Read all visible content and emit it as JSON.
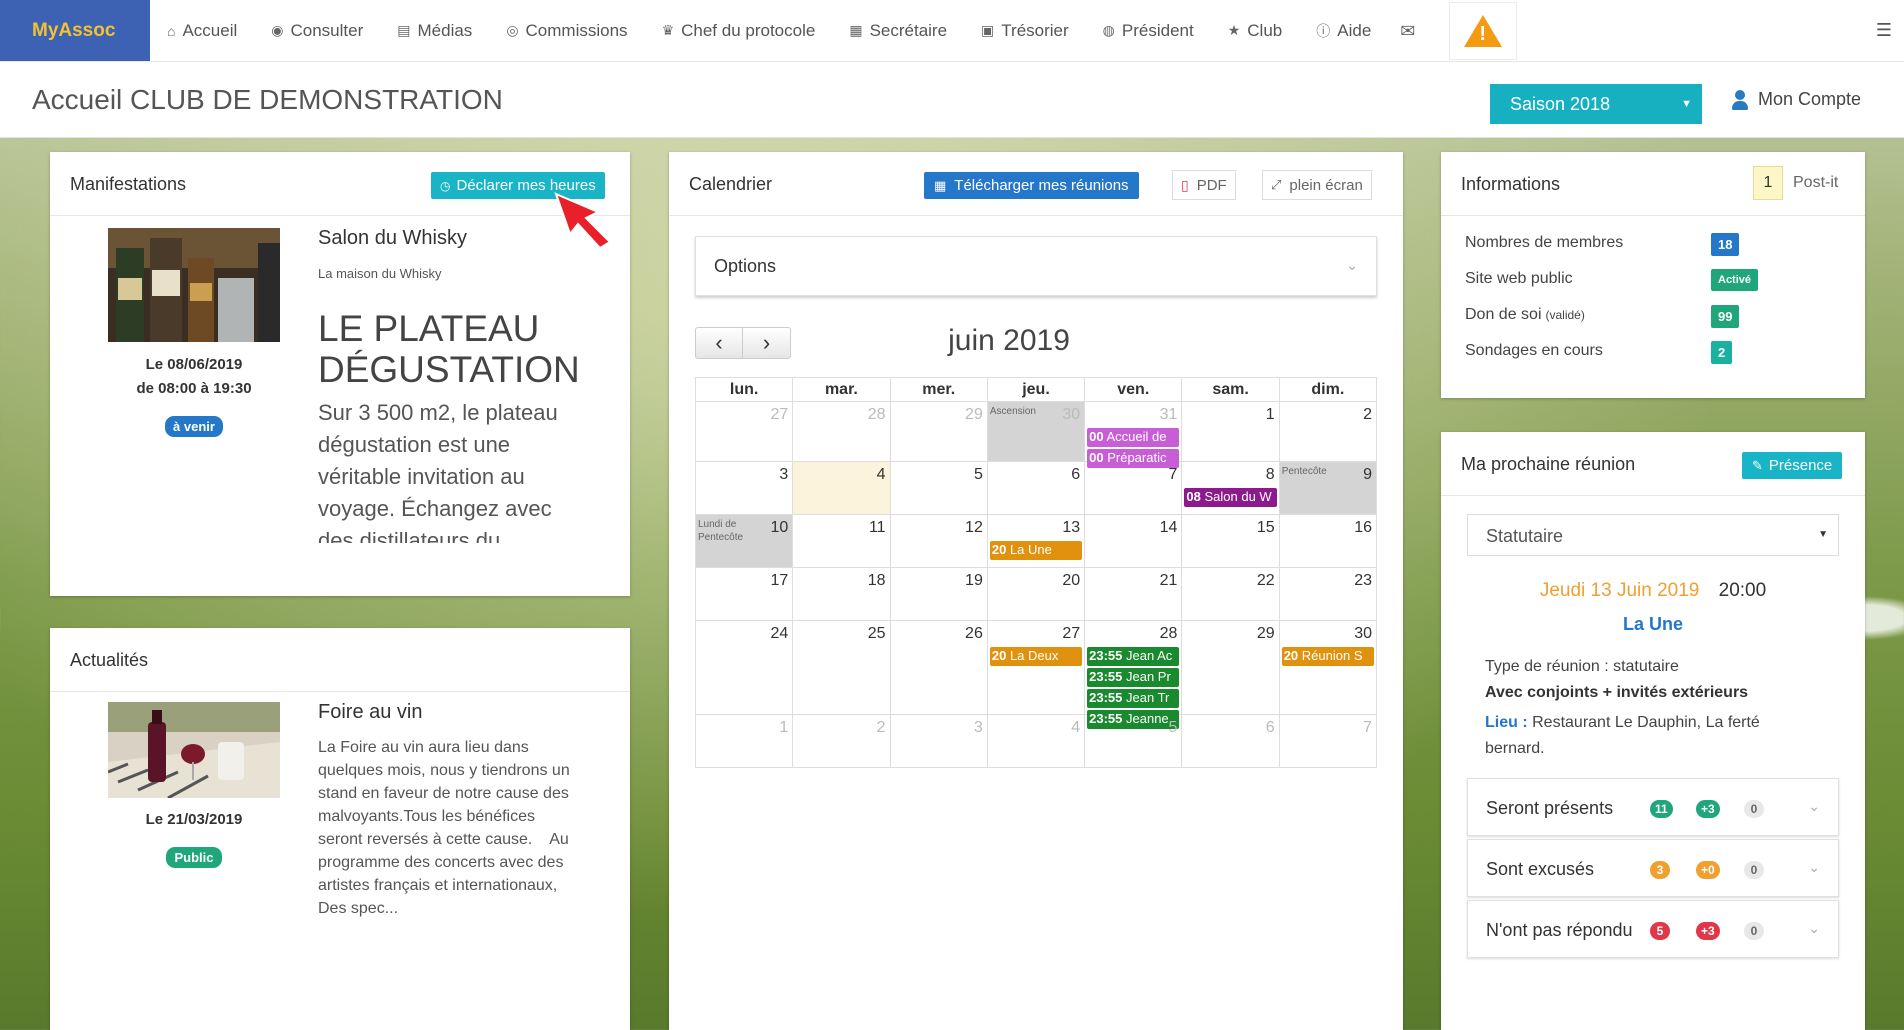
{
  "brand": "MyAssoc",
  "nav": [
    {
      "icon": "home-icon",
      "glyph": "⌂",
      "label": "Accueil"
    },
    {
      "icon": "eye-icon",
      "glyph": "◉",
      "label": "Consulter"
    },
    {
      "icon": "file-icon",
      "glyph": "▤",
      "label": "Médias"
    },
    {
      "icon": "users-icon",
      "glyph": "◎",
      "label": "Commissions"
    },
    {
      "icon": "trophy-icon",
      "glyph": "♛",
      "label": "Chef du protocole"
    },
    {
      "icon": "book-icon",
      "glyph": "▦",
      "label": "Secrétaire"
    },
    {
      "icon": "money-icon",
      "glyph": "▣",
      "label": "Trésorier"
    },
    {
      "icon": "globe-icon",
      "glyph": "◍",
      "label": "Président"
    },
    {
      "icon": "star-icon",
      "glyph": "★",
      "label": "Club"
    },
    {
      "icon": "info-icon",
      "glyph": "ⓘ",
      "label": "Aide"
    }
  ],
  "header": {
    "title": "Accueil CLUB DE DEMONSTRATION",
    "season": "Saison 2018",
    "account": "Mon Compte"
  },
  "manifestations": {
    "title": "Manifestations",
    "declare_button": "Déclarer mes heures",
    "event_title": "Salon du Whisky",
    "event_subtitle": "La maison du Whisky",
    "date_line": "Le 08/06/2019",
    "time_line": "de 08:00 à 19:30",
    "badge": "à venir",
    "headline": "LE PLATEAU DÉGUSTATION",
    "body": "Sur 3 500 m2, le plateau dégustation est une véritable invitation au voyage. Échangez avec des distillateurs du"
  },
  "actualites": {
    "title": "Actualités",
    "event_title": "Foire au vin",
    "date_line": "Le 21/03/2019",
    "badge": "Public",
    "body": "La Foire au vin aura lieu dans quelques mois, nous y tiendrons un stand en faveur de notre cause des malvoyants.Tous les bénéfices seront reversés à cette cause.    Au programme des concerts avec des artistes français et internationaux, Des spec..."
  },
  "calendar": {
    "title": "Calendrier",
    "download_button": "Télécharger mes réunions",
    "pdf_button": "PDF",
    "fullscreen_button": "plein écran",
    "options_label": "Options",
    "month_label": "juin 2019",
    "prev": "‹",
    "next": "›",
    "weekdays": [
      "lun.",
      "mar.",
      "mer.",
      "jeu.",
      "ven.",
      "sam.",
      "dim."
    ],
    "weeks": [
      [
        {
          "d": "27",
          "dim": true
        },
        {
          "d": "28",
          "dim": true
        },
        {
          "d": "29",
          "dim": true
        },
        {
          "d": "30",
          "dim": true,
          "holiday": "Ascension"
        },
        {
          "d": "31",
          "dim": true,
          "events": [
            {
              "time": "00",
              "text": "Accueil de",
              "color": "#c85ed6"
            },
            {
              "time": "00",
              "text": "Préparatic",
              "color": "#c85ed6"
            }
          ]
        },
        {
          "d": "1"
        },
        {
          "d": "2"
        }
      ],
      [
        {
          "d": "3"
        },
        {
          "d": "4",
          "today": true
        },
        {
          "d": "5"
        },
        {
          "d": "6"
        },
        {
          "d": "7"
        },
        {
          "d": "8",
          "events": [
            {
              "time": "08",
              "text": "Salon du W",
              "color": "#8c1a8c"
            }
          ]
        },
        {
          "d": "9",
          "holiday": "Pentecôte"
        }
      ],
      [
        {
          "d": "10",
          "holiday": "Lundi de Pentecôte"
        },
        {
          "d": "11"
        },
        {
          "d": "12"
        },
        {
          "d": "13",
          "events": [
            {
              "time": "20",
              "text": "La Une",
              "color": "#e0920e"
            }
          ]
        },
        {
          "d": "14"
        },
        {
          "d": "15"
        },
        {
          "d": "16"
        }
      ],
      [
        {
          "d": "17"
        },
        {
          "d": "18"
        },
        {
          "d": "19"
        },
        {
          "d": "20"
        },
        {
          "d": "21"
        },
        {
          "d": "22"
        },
        {
          "d": "23"
        }
      ],
      [
        {
          "d": "24"
        },
        {
          "d": "25"
        },
        {
          "d": "26"
        },
        {
          "d": "27",
          "events": [
            {
              "time": "20",
              "text": "La Deux",
              "color": "#e0920e"
            }
          ]
        },
        {
          "d": "28",
          "events": [
            {
              "time": "23:55",
              "text": "Jean Ac",
              "color": "#1a8a2e"
            },
            {
              "time": "23:55",
              "text": "Jean Pr",
              "color": "#1a8a2e"
            },
            {
              "time": "23:55",
              "text": "Jean Tr",
              "color": "#1a8a2e"
            },
            {
              "time": "23:55",
              "text": "Jeanne",
              "color": "#1a8a2e"
            }
          ]
        },
        {
          "d": "29"
        },
        {
          "d": "30",
          "events": [
            {
              "time": "20",
              "text": "Réunion S",
              "color": "#e0920e"
            }
          ]
        }
      ],
      [
        {
          "d": "1",
          "dim": true
        },
        {
          "d": "2",
          "dim": true
        },
        {
          "d": "3",
          "dim": true
        },
        {
          "d": "4",
          "dim": true
        },
        {
          "d": "5",
          "dim": true
        },
        {
          "d": "6",
          "dim": true
        },
        {
          "d": "7",
          "dim": true
        }
      ]
    ]
  },
  "informations": {
    "title": "Informations",
    "postit_count": "1",
    "postit_label": "Post-it",
    "rows": [
      {
        "label": "Nombres de membres",
        "note": "",
        "value": "18",
        "color": "#2577c9"
      },
      {
        "label": "Site web public",
        "note": "",
        "value": "Activé",
        "color": "#1fa67a"
      },
      {
        "label": "Don de soi",
        "note": "(validé)",
        "value": "99",
        "color": "#1fa67a"
      },
      {
        "label": "Sondages en cours",
        "note": "",
        "value": "2",
        "color": "#1ab1a0"
      }
    ]
  },
  "reunion": {
    "title": "Ma prochaine réunion",
    "presence_button": "Présence",
    "type_select": "Statutaire",
    "date": "Jeudi 13 Juin 2019",
    "time": "20:00",
    "name": "La Une",
    "type_line": "Type de réunion : statutaire",
    "guests_line": "Avec conjoints + invités extérieurs",
    "lieu_label": "Lieu :",
    "lieu_value": "Restaurant Le Dauphin, La ferté bernard.",
    "attendance": [
      {
        "label": "Seront présents",
        "a": "11",
        "a_color": "#1fa67a",
        "b": "+3",
        "b_color": "#1fa67a",
        "c": "0"
      },
      {
        "label": "Sont excusés",
        "a": "3",
        "a_color": "#f0a030",
        "b": "+0",
        "b_color": "#f0a030",
        "c": "0"
      },
      {
        "label": "N'ont pas répondu",
        "a": "5",
        "a_color": "#e0384a",
        "b": "+3",
        "b_color": "#e0384a",
        "c": "0"
      }
    ]
  }
}
